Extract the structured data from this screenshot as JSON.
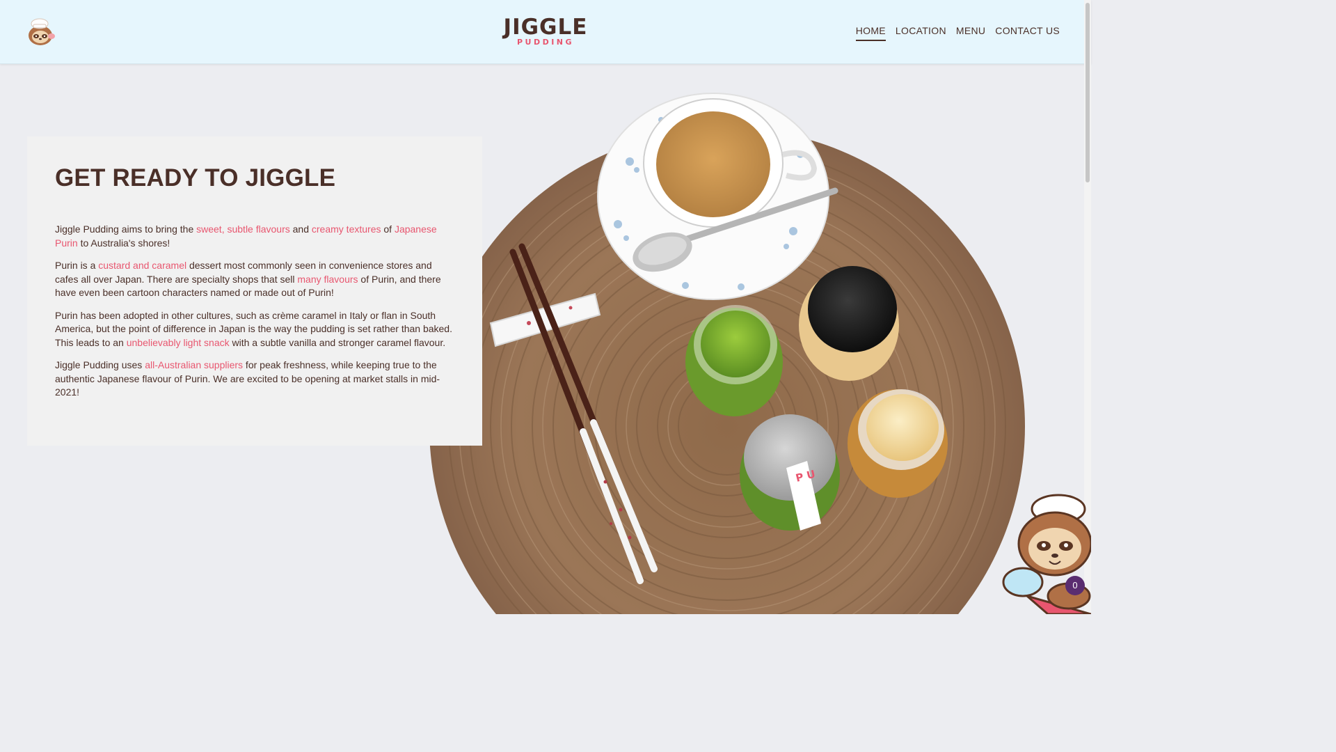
{
  "header": {
    "brand_main": "JIGGLE",
    "brand_sub": "PUDDING",
    "nav": [
      {
        "label": "HOME",
        "active": true
      },
      {
        "label": "LOCATION",
        "active": false
      },
      {
        "label": "MENU",
        "active": false
      },
      {
        "label": "CONTACT US",
        "active": false
      }
    ]
  },
  "card": {
    "title": "GET READY TO JIGGLE",
    "p1": {
      "t1": "Jiggle Pudding aims to bring the ",
      "h1": "sweet, subtle flavours",
      "t2": " and ",
      "h2": "creamy textures",
      "t3": " of ",
      "h3": "Japanese Purin",
      "t4": " to Australia's shores!"
    },
    "p2": {
      "t1": "Purin is a ",
      "h1": "custard and caramel",
      "t2": " dessert most commonly seen in convenience stores and cafes all over Japan. There are specialty shops that sell ",
      "h2": "many flavours",
      "t3": " of Purin, and there have even been cartoon characters named or made out of Purin!"
    },
    "p3": {
      "t1": "Purin has been adopted in other cultures, such as crème caramel in Italy or flan in South America, but the point of difference in Japan is the way the pudding is set rather than baked. This leads to an ",
      "h1": "unbelievably light snack",
      "t2": " with a subtle vanilla and stronger caramel flavour."
    },
    "p4": {
      "t1": "Jiggle Pudding uses ",
      "h1": "all-Australian suppliers",
      "t2": " for peak freshness, while keeping true to the authentic Japanese flavour of Purin. We are excited to be opening at market stalls in mid-2021!"
    }
  },
  "hero_image": {
    "jar_label": "PUDDING"
  },
  "chat_widget": {
    "unread_count": "0"
  },
  "colors": {
    "brand_brown": "#4a2f28",
    "accent_pink": "#e8566f",
    "header_bg": "#e6f6fd",
    "chat_badge": "#5a2d70"
  },
  "icons": {
    "logo": "sloth-chef-mascot-icon",
    "chat": "sloth-chef-chat-icon"
  }
}
